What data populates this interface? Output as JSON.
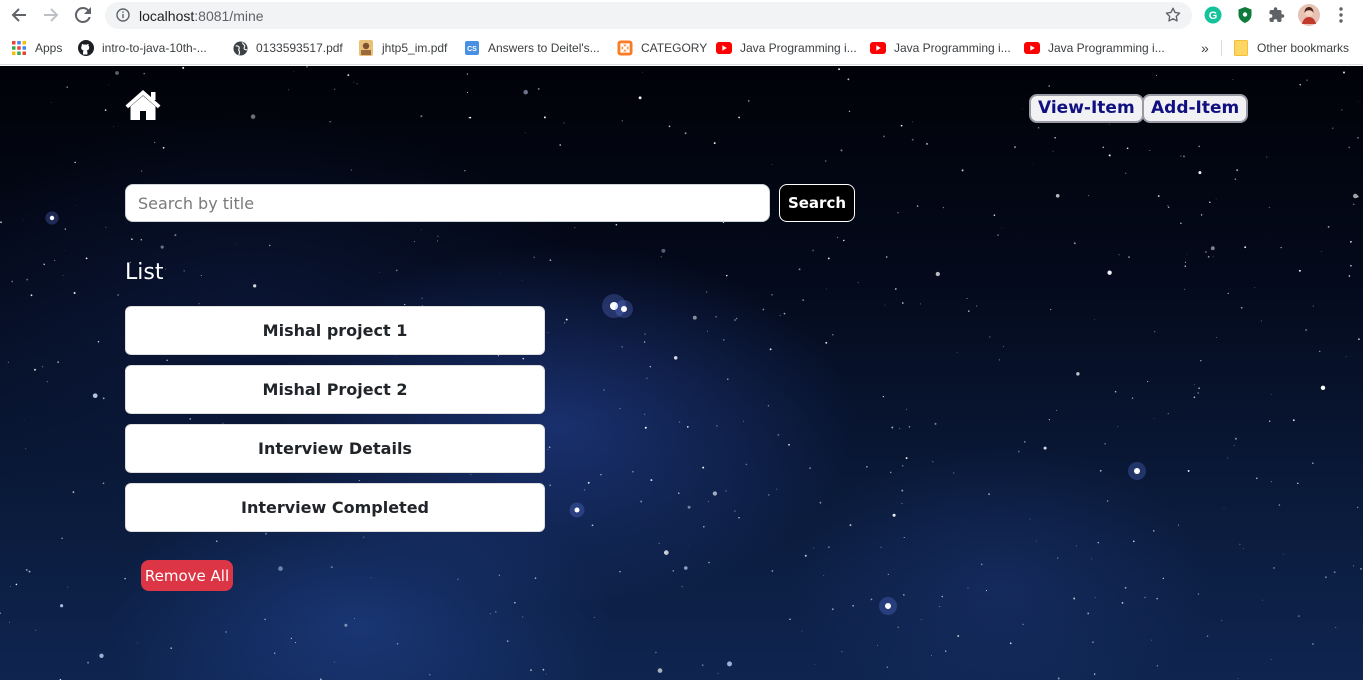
{
  "browser": {
    "url_host": "localhost",
    "url_path": ":8081/mine",
    "bookmarks": [
      {
        "label": "Apps",
        "icon": "apps-grid-icon"
      },
      {
        "label": "intro-to-java-10th-...",
        "icon": "github-icon"
      },
      {
        "label": "0133593517.pdf",
        "icon": "globe-icon"
      },
      {
        "label": "jhtp5_im.pdf",
        "icon": "pdf-thumb-icon"
      },
      {
        "label": "Answers to Deitel's...",
        "icon": "cs-icon"
      },
      {
        "label": "CATEGORY",
        "icon": "xampp-icon"
      },
      {
        "label": "Java Programming i...",
        "icon": "youtube-icon"
      },
      {
        "label": "Java Programming i...",
        "icon": "youtube-icon"
      },
      {
        "label": "Java Programming i...",
        "icon": "youtube-icon"
      }
    ],
    "overflow_label": "»",
    "other_bookmarks": "Other bookmarks"
  },
  "nav": {
    "view_item": "View-Item",
    "add_item": "Add-Item"
  },
  "search": {
    "placeholder": "Search by title",
    "button": "Search"
  },
  "list": {
    "title": "List",
    "items": [
      "Mishal project 1",
      "Mishal Project 2",
      "Interview Details",
      "Interview Completed"
    ]
  },
  "remove_all": "Remove All",
  "colors": {
    "nav_text": "#101080",
    "remove_button": "#dc3545",
    "background": "#040a1c"
  }
}
